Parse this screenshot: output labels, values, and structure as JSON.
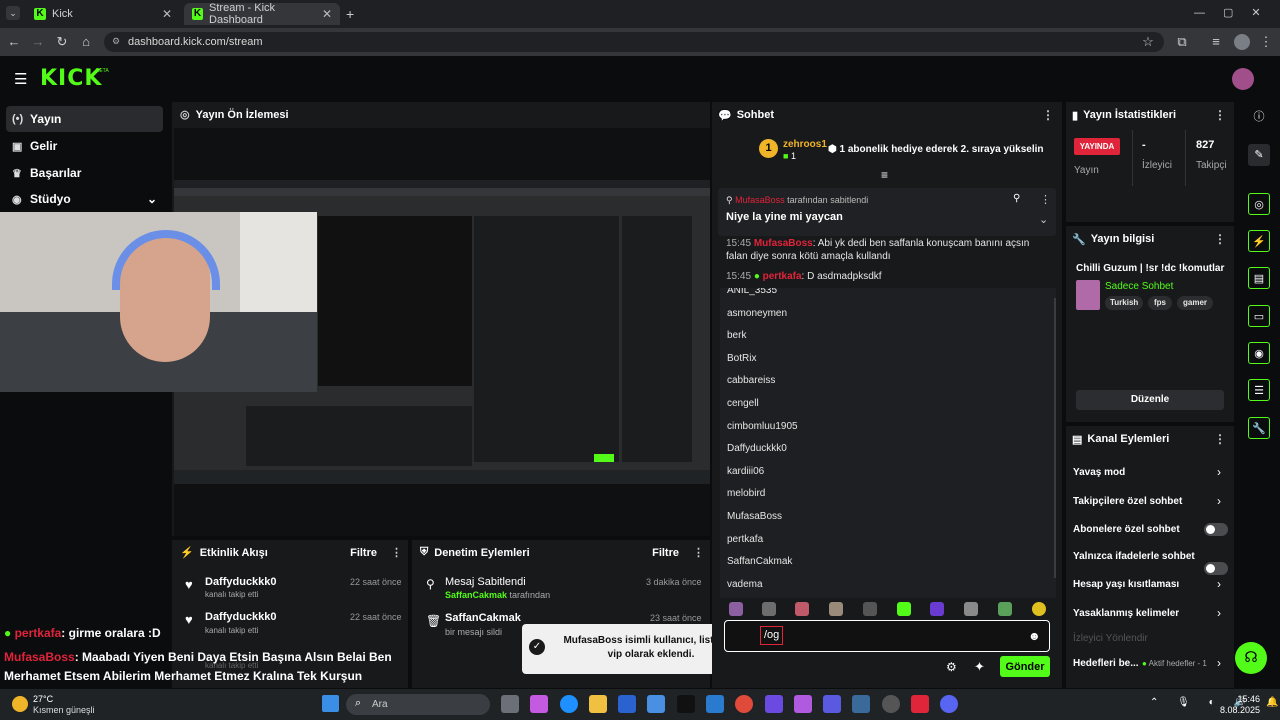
{
  "browser": {
    "tabs": [
      {
        "label": "Kick"
      },
      {
        "label": "Stream - Kick Dashboard"
      }
    ],
    "url": "dashboard.kick.com/stream"
  },
  "app": {
    "logo": "KICK",
    "beta": "BETA"
  },
  "sidebar": {
    "items": [
      {
        "label": "Yayın",
        "icon": "broadcast-icon"
      },
      {
        "label": "Gelir",
        "icon": "revenue-icon"
      },
      {
        "label": "Başarılar",
        "icon": "trophy-icon"
      },
      {
        "label": "Stüdyo",
        "icon": "studio-icon"
      }
    ]
  },
  "preview": {
    "title": "Yayın Ön İzlemesi"
  },
  "overlay_chat": {
    "line1_user": "pertkafa",
    "line1_text": ": girme oralara :D",
    "line2_user": "MufasaBoss",
    "line2_text": ": Maabadı Yiyen Beni Daya Etsin Başına Alsın Belai Ben Merhamet Etsem Abilerim Merhamet Etmez Kralına Tek Kurşun @SaffanCakmak"
  },
  "activity": {
    "title": "Etkinlik Akışı",
    "filter": "Filtre",
    "items": [
      {
        "user": "Daffyduckkk0",
        "desc": "kanalı takip etti",
        "time": "22 saat önce"
      },
      {
        "user": "Daffyduckkk0",
        "desc": "kanalı takip etti",
        "time": "22 saat önce"
      },
      {
        "user": "Daffyduckkk0",
        "desc": "kanalı takip etti",
        "time": "22 saat önce"
      }
    ]
  },
  "moderation": {
    "title": "Denetim Eylemleri",
    "filter": "Filtre",
    "items": [
      {
        "title": "Mesaj Sabitlendi",
        "actor": "SaffanCakmak",
        "suffix": "tarafından",
        "time": "3 dakika önce"
      },
      {
        "title": "SaffanCakmak",
        "desc": "bir mesajı sildi",
        "time": "23 saat önce"
      }
    ]
  },
  "toast": {
    "text": "MufasaBoss isimli kullanıcı, listenize vip olarak eklendi."
  },
  "chat": {
    "title": "Sohbet",
    "gift_user": "zehroos1",
    "gift_count": "1",
    "gift_text": "1 abonelik hediye ederek 2. sıraya yükselin",
    "gift_rank": "1",
    "pinned_by": "MufasaBoss",
    "pinned_suffix": "tarafından sabitlendi",
    "pinned_text": "Niye la yine mi yaycan",
    "messages": [
      {
        "time": "15:45",
        "user": "MufasaBoss",
        "text": ": Abi yk dedi ben saffanla konuşcam banını açsın falan diye sonra kötü amaçla kullandı"
      },
      {
        "time": "15:45",
        "user": "pertkafa",
        "text": ": D asdmadpksdkf"
      }
    ],
    "users": [
      "ANIL_3535",
      "asmoneymen",
      "berk",
      "BotRix",
      "cabbareiss",
      "cengell",
      "cimbomluu1905",
      "Daffyduckkk0",
      "kardiii06",
      "melobird",
      "MufasaBoss",
      "pertkafa",
      "SaffanCakmak",
      "vadema"
    ],
    "input_value": "/og",
    "send": "Gönder"
  },
  "stats": {
    "title": "Yayın İstatistikleri",
    "live": "YAYINDA",
    "live_label": "Yayın",
    "viewers_value": "-",
    "viewers_label": "İzleyici",
    "followers_value": "827",
    "followers_label": "Takipçi"
  },
  "info": {
    "title": "Yayın bilgisi",
    "stream_title": "Chilli Guzum | !sr !dc !komutlar",
    "category": "Sadece Sohbet",
    "tags": [
      "Turkish",
      "fps",
      "gamer"
    ],
    "edit": "Düzenle"
  },
  "actions": {
    "title": "Kanal Eylemleri",
    "items": [
      {
        "label": "Yavaş mod",
        "kind": "chevron"
      },
      {
        "label": "Takipçilere özel sohbet",
        "kind": "chevron"
      },
      {
        "label": "Abonelere özel sohbet",
        "kind": "toggle"
      },
      {
        "label": "Yalnızca ifadelerle sohbet",
        "kind": "toggle"
      },
      {
        "label": "Hesap yaşı kısıtlaması",
        "kind": "chevron"
      },
      {
        "label": "Yasaklanmış kelimeler",
        "kind": "chevron"
      }
    ],
    "faded": "İzleyici Yönlendir",
    "goals": "Hedefleri be...",
    "goals_status": "Aktif hedefler - 1"
  },
  "taskbar": {
    "weather_temp": "27°C",
    "weather_desc": "Kısmen güneşli",
    "search": "Ara",
    "time": "15:46",
    "date": "8.08.2025"
  },
  "colors": {
    "accent": "#53fc18",
    "live": "#e0243a",
    "mention": "#e0243a"
  }
}
